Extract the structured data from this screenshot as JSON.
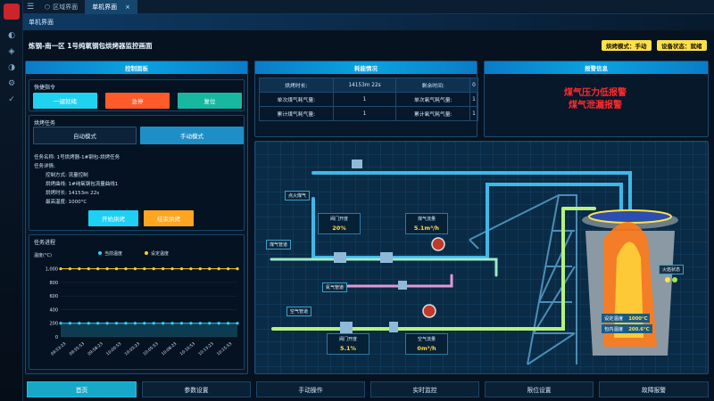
{
  "tabs": [
    {
      "label": "区域界面"
    },
    {
      "label": "单机界面"
    }
  ],
  "subheader": "单机界面",
  "page_title": "炼钢-南一区 1号纯氧钢包烘烤器监控画面",
  "badges": {
    "bake_mode": "烘烤模式：手动",
    "device_status": "设备状态：就绪"
  },
  "control": {
    "title": "控制面板",
    "quick_title": "快捷指令",
    "one_key": "一键就绪",
    "estop": "急停",
    "reset": "复位",
    "task_title": "烘烤任务",
    "auto_mode": "自动模式",
    "manual_mode": "手动模式",
    "task_name": "任务名称: 1号烘烤器-1#钢包-烘烤任务",
    "task_detail": "任务详情:",
    "ctrl_method": "控制方式: 流量控制",
    "curve": "烘烤曲线: 1#纯氧钢包流量曲线1",
    "duration": "烘烤时长: 14153m 22s",
    "max_temp": "最高温度: 1000°C",
    "start": "开始烘烤",
    "stop": "结束烘烤",
    "progress_title": "任务进程"
  },
  "energy": {
    "title": "耗能情况",
    "rows": [
      [
        "烘烤时长:",
        "14153m 22s",
        "剩余时间:",
        "0"
      ],
      [
        "单次煤气耗气量:",
        "1",
        "单次氧气耗气量:",
        "1"
      ],
      [
        "累计煤气耗气量:",
        "1",
        "累计氧气耗气量:",
        "1"
      ]
    ]
  },
  "alarm": {
    "title": "报警信息",
    "items": [
      "煤气压力低报警",
      "煤气泄漏报警"
    ]
  },
  "chart_data": {
    "type": "line",
    "ylabel": "温度(°C)",
    "series": [
      {
        "name": "当前温度",
        "color": "#2fd0ff",
        "values": [
          200,
          200,
          200,
          200,
          200,
          200,
          200,
          200,
          200,
          200,
          200,
          200,
          200,
          200,
          200,
          200,
          200,
          200,
          200,
          200
        ]
      },
      {
        "name": "设定温度",
        "color": "#ffcc33",
        "values": [
          1000,
          1000,
          1000,
          1000,
          1000,
          1000,
          1000,
          1000,
          1000,
          1000,
          1000,
          1000,
          1000,
          1000,
          1000,
          1000,
          1000,
          1000,
          1000,
          1000
        ]
      }
    ],
    "yticks": [
      "0",
      "200",
      "400",
      "600",
      "800",
      "1,000"
    ],
    "ylim": [
      0,
      1100
    ],
    "xticks": [
      "09:53:23",
      "09:55:53",
      "09:58:23",
      "10:00:53",
      "10:03:23",
      "10:05:53",
      "10:08:23",
      "10:10:53",
      "10:13:23",
      "10:15:53"
    ],
    "legend": "top"
  },
  "process": {
    "ignition_gas": "点火煤气",
    "gas_pipe": "煤气管道",
    "n2_pipe": "氮气管道",
    "air_pipe": "空气管道",
    "valve_open_1": "阀门开度",
    "valve_val_1": "20%",
    "gas_flow": "煤气流量",
    "gas_flow_val": "5.1m³/h",
    "valve_open_2": "阀门开度",
    "valve_val_2": "5.1%",
    "air_flow": "空气流量",
    "air_flow_val": "0m³/h",
    "flame_status": "火焰状态",
    "set_temp_label": "设定温度",
    "set_temp_val": "1000°C",
    "inner_temp_label": "包内温度",
    "inner_temp_val": "200.6°C"
  },
  "nav": [
    "首页",
    "参数设置",
    "手动操作",
    "实时监控",
    "限位设置",
    "故障报警"
  ]
}
